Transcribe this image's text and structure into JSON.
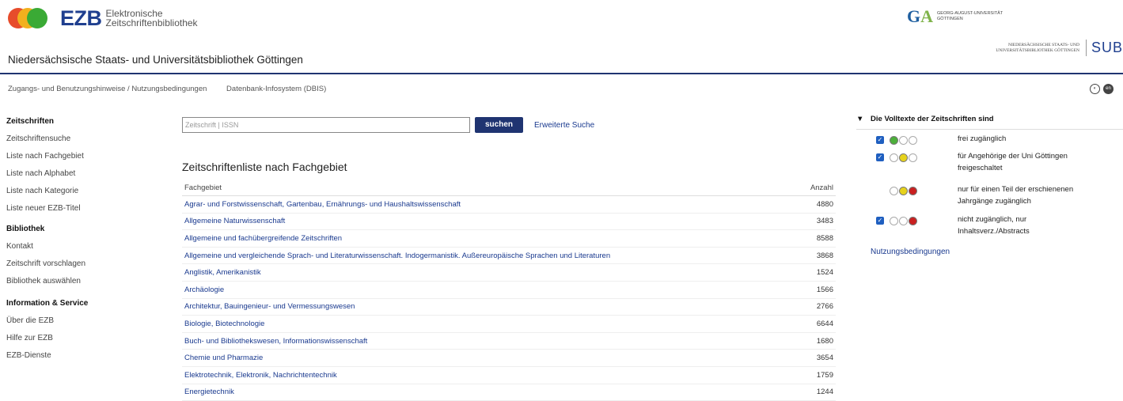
{
  "header": {
    "logo_text": "EZB",
    "logo_sub1": "Elektronische",
    "logo_sub2": "Zeitschriftenbibliothek",
    "library_title": "Niedersächsische Staats- und Universitätsbibliothek Göttingen",
    "goe_line1": "GEORG-AUGUST-UNIVERSITÄT",
    "goe_line2": "GÖTTINGEN",
    "sub_line1": "NIEDERSÄCHSISCHE STAATS- UND",
    "sub_line2": "UNIVERSITÄTSBIBLIOTHEK GÖTTINGEN",
    "sub_mark": "SUB"
  },
  "topnav": {
    "item1": "Zugangs- und Benutzungshinweise / Nutzungsbedingungen",
    "item2": "Datenbank-Infosystem (DBIS)"
  },
  "sidebar": {
    "sections": [
      {
        "title": "Zeitschriften",
        "items": [
          "Zeitschriftensuche",
          "Liste nach Fachgebiet",
          "Liste nach Alphabet",
          "Liste nach Kategorie",
          "Liste neuer EZB-Titel"
        ]
      },
      {
        "title": "Bibliothek",
        "items": [
          "Kontakt",
          "Zeitschrift vorschlagen",
          "Bibliothek auswählen"
        ]
      },
      {
        "title": "Information & Service",
        "items": [
          "Über die EZB",
          "Hilfe zur EZB",
          "EZB-Dienste"
        ]
      }
    ]
  },
  "search": {
    "placeholder": "Zeitschrift | ISSN",
    "button": "suchen",
    "advanced": "Erweiterte Suche"
  },
  "list": {
    "title": "Zeitschriftenliste nach Fachgebiet",
    "col_subject": "Fachgebiet",
    "col_count": "Anzahl",
    "rows": [
      {
        "name": "Agrar- und Forstwissenschaft, Gartenbau, Ernährungs- und Haushaltswissenschaft",
        "count": "4880"
      },
      {
        "name": "Allgemeine Naturwissenschaft",
        "count": "3483"
      },
      {
        "name": "Allgemeine und fachübergreifende Zeitschriften",
        "count": "8588"
      },
      {
        "name": "Allgemeine und vergleichende Sprach- und Literaturwissenschaft. Indogermanistik. Außereuropäische Sprachen und Literaturen",
        "count": "3868"
      },
      {
        "name": "Anglistik, Amerikanistik",
        "count": "1524"
      },
      {
        "name": "Archäologie",
        "count": "1566"
      },
      {
        "name": "Architektur, Bauingenieur- und Vermessungswesen",
        "count": "2766"
      },
      {
        "name": "Biologie, Biotechnologie",
        "count": "6644"
      },
      {
        "name": "Buch- und Bibliothekswesen, Informationswissenschaft",
        "count": "1680"
      },
      {
        "name": "Chemie und Pharmazie",
        "count": "3654"
      },
      {
        "name": "Elektrotechnik, Elektronik, Nachrichtentechnik",
        "count": "1759"
      },
      {
        "name": "Energietechnik",
        "count": "1244"
      }
    ]
  },
  "legend": {
    "title": "Die Volltexte der Zeitschriften sind",
    "rows": [
      {
        "checked": true,
        "lamps": [
          "#4caf3a",
          "#fff",
          "#fff"
        ],
        "text": "frei zugänglich"
      },
      {
        "checked": true,
        "lamps": [
          "#fff",
          "#e6d21c",
          "#fff"
        ],
        "text": "für Angehörige der Uni Göttingen freigeschaltet"
      },
      {
        "checked": false,
        "lamps": [
          "#fff",
          "#e6d21c",
          "#c92020"
        ],
        "text": "nur für einen Teil der erschienenen Jahrgänge zugänglich"
      },
      {
        "checked": true,
        "lamps": [
          "#fff",
          "#fff",
          "#c92020"
        ],
        "text": "nicht zugänglich, nur Inhaltsverz./Abstracts"
      }
    ],
    "link": "Nutzungsbedingungen"
  },
  "colors": {
    "brand": "#1f3471",
    "link": "#1a3a8f"
  }
}
